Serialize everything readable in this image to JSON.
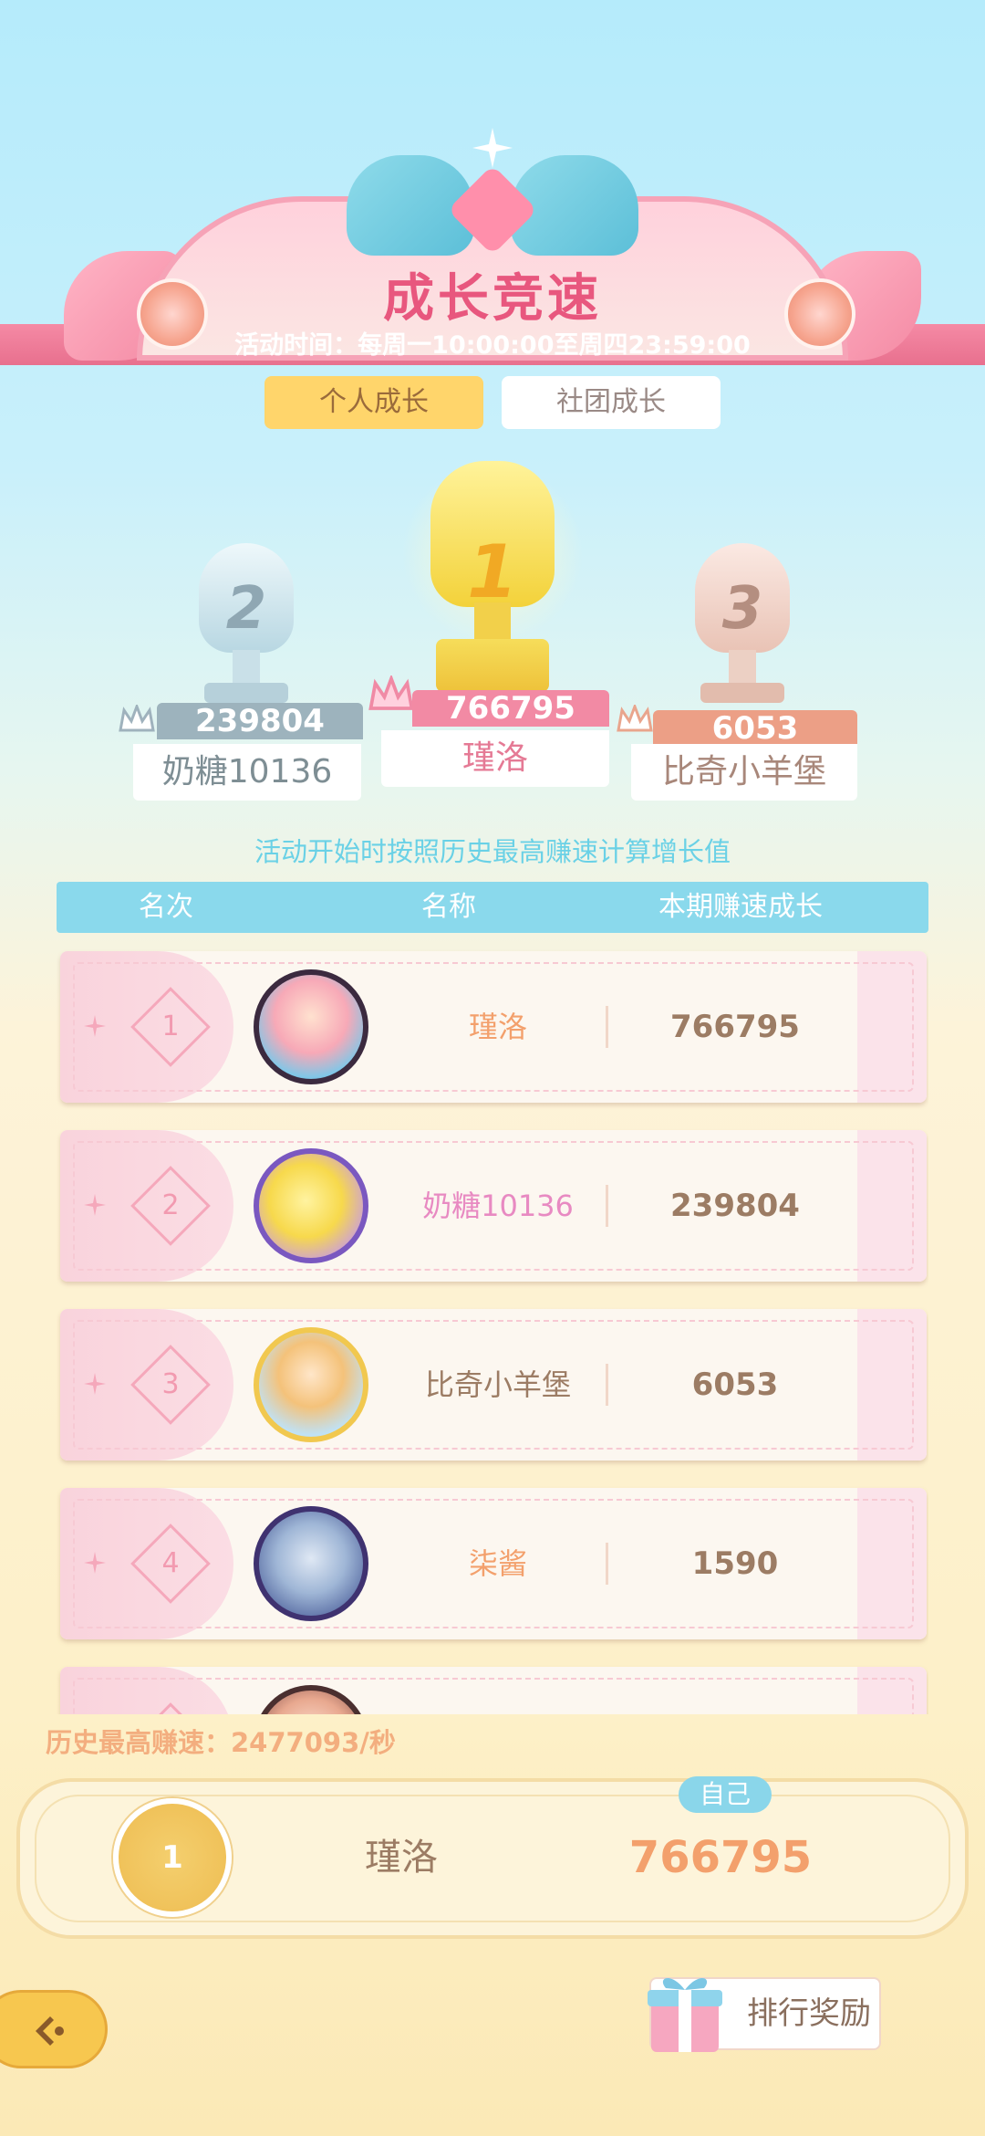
{
  "header": {
    "title": "成长竞速",
    "subtitle": "活动时间：每周一10:00:00至周四23:59:00"
  },
  "tabs": {
    "personal": "个人成长",
    "club": "社团成长"
  },
  "podium": {
    "first": {
      "rank": "1",
      "score": "766795",
      "name": "瑾洛"
    },
    "second": {
      "rank": "2",
      "score": "239804",
      "name": "奶糖10136"
    },
    "third": {
      "rank": "3",
      "score": "6053",
      "name": "比奇小羊堡"
    }
  },
  "note": "活动开始时按照历史最高赚速计算增长值",
  "table": {
    "headers": {
      "rank": "名次",
      "name": "名称",
      "growth": "本期赚速成长"
    },
    "rows": [
      {
        "rank": "1",
        "name": "瑾洛",
        "score": "766795"
      },
      {
        "rank": "2",
        "name": "奶糖10136",
        "score": "239804"
      },
      {
        "rank": "3",
        "name": "比奇小羊堡",
        "score": "6053"
      },
      {
        "rank": "4",
        "name": "柒酱",
        "score": "1590"
      }
    ]
  },
  "history": "历史最高赚速：2477093/秒",
  "self": {
    "tag": "自己",
    "rank": "1",
    "name": "瑾洛",
    "score": "766795"
  },
  "reward_button": "排行奖励",
  "colors": {
    "title_pink": "#e8577e",
    "tab_active": "#ffd56b",
    "table_header": "#8ad9ec",
    "rank_pink": "#f29ab0",
    "score_brown": "#9c7c64",
    "self_score_orange": "#f3a06c"
  }
}
